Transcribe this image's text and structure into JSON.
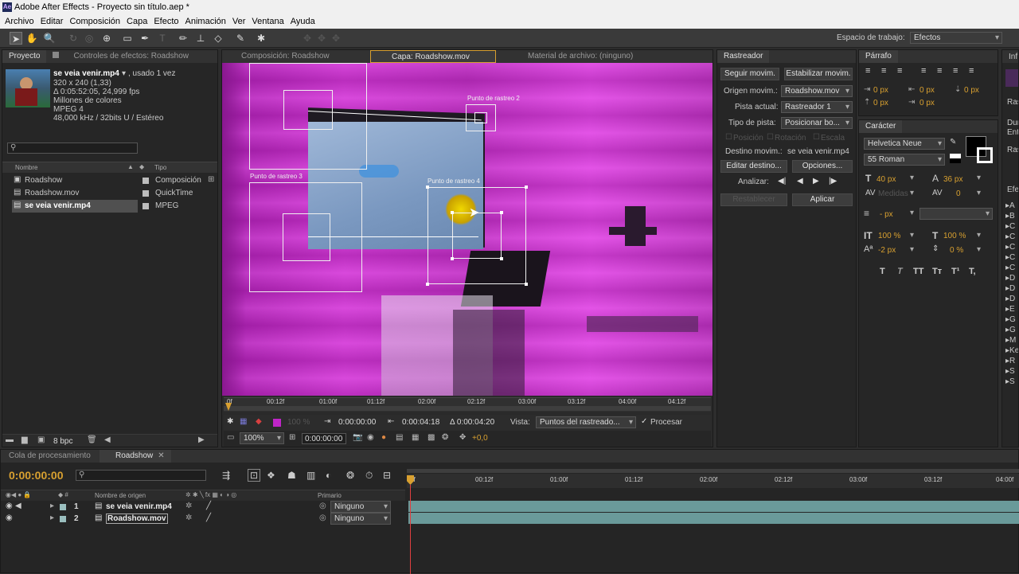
{
  "window": {
    "title": "Adobe After Effects - Proyecto sin título.aep *",
    "app_icon": "Ae"
  },
  "menu": [
    "Archivo",
    "Editar",
    "Composición",
    "Capa",
    "Efecto",
    "Animación",
    "Ver",
    "Ventana",
    "Ayuda"
  ],
  "workspace": {
    "label": "Espacio de trabajo:",
    "value": "Efectos"
  },
  "project_panel": {
    "tabs": [
      "Proyecto",
      "Controles de efectos: Roadshow"
    ],
    "selected_name": "se veia venir.mp4",
    "selected_usage": ", usado 1 vez",
    "info": [
      "320 x 240 (1,33)",
      "Δ 0:05:52:05, 24,999 fps",
      "Millones de colores",
      "MPEG 4",
      "48,000 kHz / 32bits U / Estéreo"
    ],
    "columns": {
      "name": "Nombre",
      "type": "Tipo"
    },
    "items": [
      {
        "name": "Roadshow",
        "type": "Composición",
        "icon": "composition-icon"
      },
      {
        "name": "Roadshow.mov",
        "type": "QuickTime",
        "icon": "footage-icon"
      },
      {
        "name": "se veia venir.mp4",
        "type": "MPEG",
        "icon": "footage-icon"
      }
    ],
    "bpc": "8 bpc"
  },
  "viewer": {
    "tabs": [
      "Composición: Roadshow",
      "Capa: Roadshow.mov",
      "Material de archivo: (ninguno)"
    ],
    "track_points": [
      "Punto de rastreo 2",
      "Punto de rastreo 3",
      "Punto de rastreo 4"
    ],
    "ruler": [
      "0f",
      "00:12f",
      "01:00f",
      "01:12f",
      "02:00f",
      "02:12f",
      "03:00f",
      "03:12f",
      "04:00f",
      "04:12f"
    ],
    "time_in": "0:00:00:00",
    "time_out": "0:00:04:18",
    "duration": "Δ 0:00:04:20",
    "percent": "100 %",
    "view_label": "Vista:",
    "view_value": "Puntos del rastreado...",
    "render_label": "Procesar",
    "zoom": "100%",
    "current_time": "0:00:00:00",
    "offset": "+0,0"
  },
  "tracker": {
    "title": "Rastreador",
    "btn_track": "Seguir movim.",
    "btn_stabilize": "Estabilizar movim.",
    "origin_label": "Origen movim.:",
    "origin_value": "Roadshow.mov",
    "current_label": "Pista actual:",
    "current_value": "Rastreador 1",
    "type_label": "Tipo de pista:",
    "type_value": "Posicionar bo...",
    "opt_position": "Posición",
    "opt_rotation": "Rotación",
    "opt_scale": "Escala",
    "target_label": "Destino movim.:",
    "target_value": "se veia venir.mp4",
    "btn_edit_target": "Editar destino...",
    "btn_options": "Opciones...",
    "analyze_label": "Analizar:",
    "btn_reset": "Restablecer",
    "btn_apply": "Aplicar"
  },
  "paragraph": {
    "title": "Párrafo",
    "values": [
      "0 px",
      "0 px",
      "0 px",
      "0 px",
      "0 px"
    ]
  },
  "character": {
    "title": "Carácter",
    "font": "Helvetica Neue",
    "style": "55 Roman",
    "size": "40 px",
    "leading": "36 px",
    "kerning": "Medidas",
    "tracking": "0",
    "stroke": "- px",
    "v_scale": "100 %",
    "h_scale": "100 %",
    "baseline": "-2 px",
    "tsume": "0 %",
    "styles": [
      "T",
      "T",
      "TT",
      "Tт",
      "T¹",
      "T,"
    ]
  },
  "right_edge": {
    "tabs": [
      "Inf",
      "Ras",
      "Efe"
    ],
    "lines": [
      "Ras",
      "Dur",
      "Entr"
    ],
    "list": [
      "A",
      "B",
      "C",
      "C",
      "C",
      "C",
      "C",
      "D",
      "D",
      "D",
      "E",
      "G",
      "G",
      "M",
      "Ke",
      "R",
      "S",
      "S"
    ]
  },
  "bottom_tabs": [
    "Cola de procesamiento",
    "Roadshow"
  ],
  "timeline": {
    "time": "0:00:00:00",
    "col_source": "Nombre de origen",
    "col_parent": "Primario",
    "ruler": [
      "0f",
      "00:12f",
      "01:00f",
      "01:12f",
      "02:00f",
      "02:12f",
      "03:00f",
      "03:12f",
      "04:00f"
    ],
    "layers": [
      {
        "num": "1",
        "name": "se veia venir.mp4",
        "parent": "Ninguno"
      },
      {
        "num": "2",
        "name": "Roadshow.mov",
        "parent": "Ninguno"
      }
    ]
  },
  "colors": {
    "accent": "#d8a030",
    "magenta": "#c025c8",
    "layer_bar": "#6a9a9a",
    "playhead": "#e04040"
  }
}
